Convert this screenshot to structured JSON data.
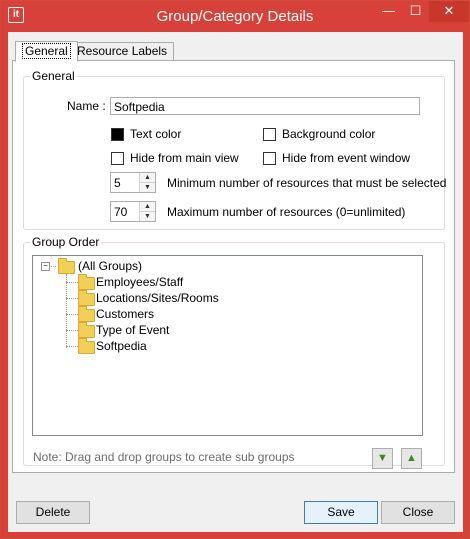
{
  "window": {
    "title": "Group/Category Details",
    "icon_label": "it",
    "controls": {
      "minimize": "—",
      "maximize": "☐",
      "close": "✕"
    }
  },
  "tabs": [
    {
      "label": "General",
      "active": true
    },
    {
      "label": "Resource Labels",
      "active": false
    }
  ],
  "general": {
    "legend": "General",
    "name_label": "Name :",
    "name_value": "Softpedia",
    "checkboxes": {
      "text_color": {
        "label": "Text color",
        "filled": true
      },
      "background_color": {
        "label": "Background color",
        "filled": false
      },
      "hide_main_view": {
        "label": "Hide from main view",
        "filled": false
      },
      "hide_event_window": {
        "label": "Hide from event window",
        "filled": false
      }
    },
    "min_resources": {
      "value": "5",
      "label": "Minimum number of resources that must be selected"
    },
    "max_resources": {
      "value": "70",
      "label": "Maximum number of resources (0=unlimited)"
    }
  },
  "group_order": {
    "legend": "Group Order",
    "root": {
      "label": "(All Groups)",
      "expander": "−"
    },
    "children": [
      {
        "label": "Employees/Staff"
      },
      {
        "label": "Locations/Sites/Rooms"
      },
      {
        "label": "Customers"
      },
      {
        "label": "Type of Event"
      },
      {
        "label": "Softpedia"
      }
    ],
    "note": "Note: Drag and drop groups to create sub groups",
    "move_down_icon": "arrow-down",
    "move_up_icon": "arrow-up"
  },
  "footer": {
    "delete_label": "Delete",
    "save_label": "Save",
    "close_label": "Close"
  },
  "colors": {
    "titlebar": "#d8413a",
    "dialog_bg": "#f0f0f0",
    "folder": "#f2cf57",
    "arrow_green": "#3a8a20"
  }
}
